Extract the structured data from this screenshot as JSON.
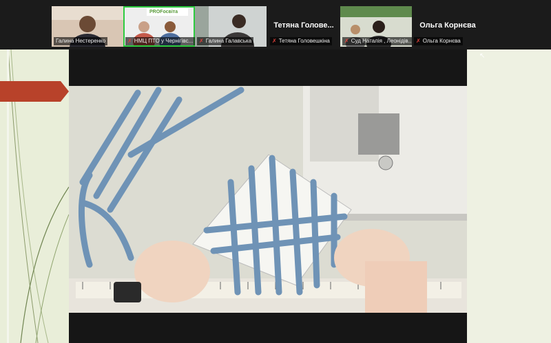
{
  "participants": [
    {
      "name": "Галина Нестеренко",
      "muted": false
    },
    {
      "name": "НМЦ ПТО у Чернігівс...",
      "muted": true
    },
    {
      "name": "Галина Галавська",
      "muted": true
    },
    {
      "name": "Тетяна Головешкіна",
      "muted": true,
      "big_label": "Тетяна  Голове..."
    },
    {
      "name": "Суд Наталія , Леонідів...",
      "muted": true
    },
    {
      "name": "Ольга Корнєва",
      "muted": true,
      "big_label": "Ольга Корнєва"
    }
  ],
  "banner_text": "PROFосвіта",
  "colors": {
    "strip_bg": "#1b1b1b",
    "active": "#2ecc40",
    "slide_bg": "#e5ebd4",
    "arrow": "#b8422a",
    "tape": "#6f93b6"
  }
}
